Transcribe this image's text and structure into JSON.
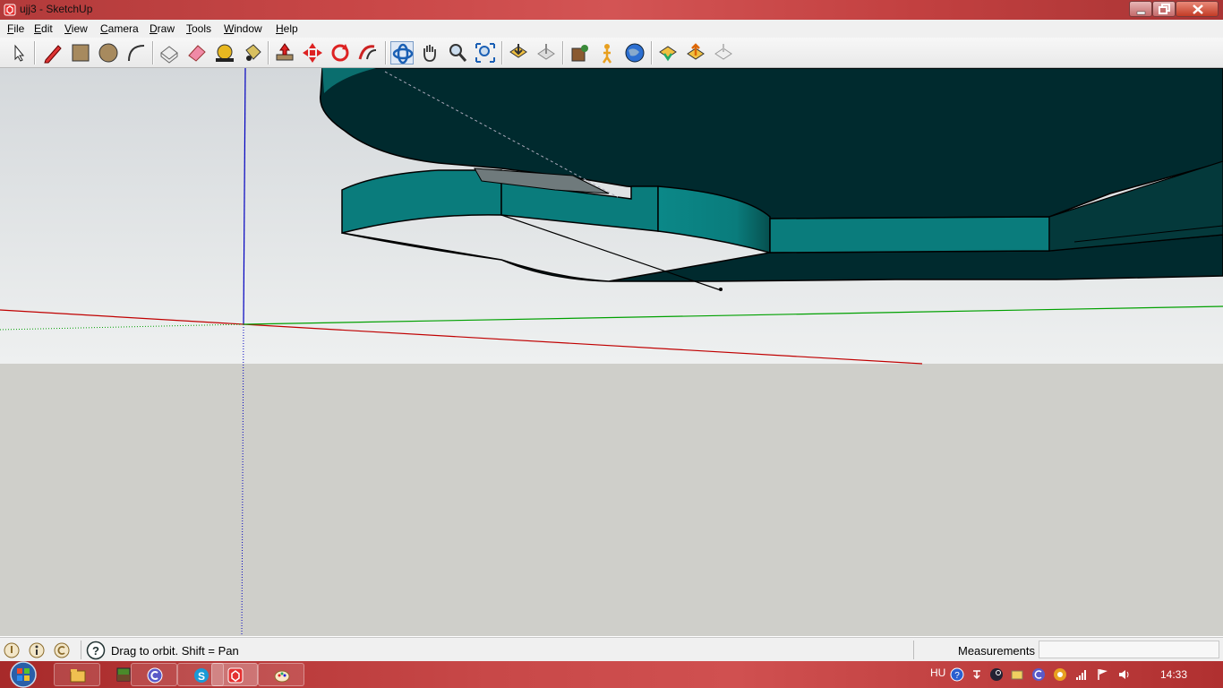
{
  "window": {
    "title": "ujj3 - SketchUp",
    "controls": [
      "minimize",
      "maximize",
      "close"
    ]
  },
  "menubar": {
    "items": [
      {
        "label": "File"
      },
      {
        "label": "Edit"
      },
      {
        "label": "View"
      },
      {
        "label": "Camera"
      },
      {
        "label": "Draw"
      },
      {
        "label": "Tools"
      },
      {
        "label": "Window"
      },
      {
        "label": "Help"
      }
    ]
  },
  "toolbar": {
    "tools": [
      {
        "name": "select-tool-icon"
      },
      {
        "name": "pencil-line-icon"
      },
      {
        "name": "rectangle-icon"
      },
      {
        "name": "circle-icon"
      },
      {
        "name": "arc-icon"
      },
      {
        "name": "make-component-icon"
      },
      {
        "name": "eraser-icon"
      },
      {
        "name": "tape-measure-icon"
      },
      {
        "name": "paint-bucket-icon"
      },
      {
        "name": "push-pull-icon"
      },
      {
        "name": "move-icon"
      },
      {
        "name": "rotate-icon"
      },
      {
        "name": "follow-me-icon"
      },
      {
        "name": "orbit-icon"
      },
      {
        "name": "pan-icon"
      },
      {
        "name": "zoom-icon"
      },
      {
        "name": "zoom-extents-icon"
      },
      {
        "name": "get-models-icon"
      },
      {
        "name": "share-model-icon"
      },
      {
        "name": "add-location-icon"
      },
      {
        "name": "position-camera-icon"
      },
      {
        "name": "walk-icon"
      },
      {
        "name": "google-earth-icon"
      },
      {
        "name": "get-photo-texture-icon"
      },
      {
        "name": "share-component-icon"
      },
      {
        "name": "dynamic-components-icon"
      }
    ],
    "active_tool": "orbit-icon"
  },
  "viewport": {
    "sky_color": "#dde0e2",
    "ground_color": "#cfcfca",
    "model_top_color": "#002a2e",
    "model_side_color": "#0a7c7c",
    "axis_red": "#c00000",
    "axis_green": "#00a000",
    "axis_blue": "#0000c0"
  },
  "statusbar": {
    "help_text": "Drag to orbit.  Shift = Pan",
    "measurements_label": "Measurements",
    "measurements_value": ""
  },
  "taskbar": {
    "buttons": [
      {
        "name": "taskbar-explorer"
      },
      {
        "name": "taskbar-minecraft"
      },
      {
        "name": "taskbar-app-c"
      },
      {
        "name": "taskbar-skype"
      },
      {
        "name": "taskbar-sketchup"
      },
      {
        "name": "taskbar-paint"
      }
    ],
    "language": "HU",
    "clock": "14:33"
  }
}
